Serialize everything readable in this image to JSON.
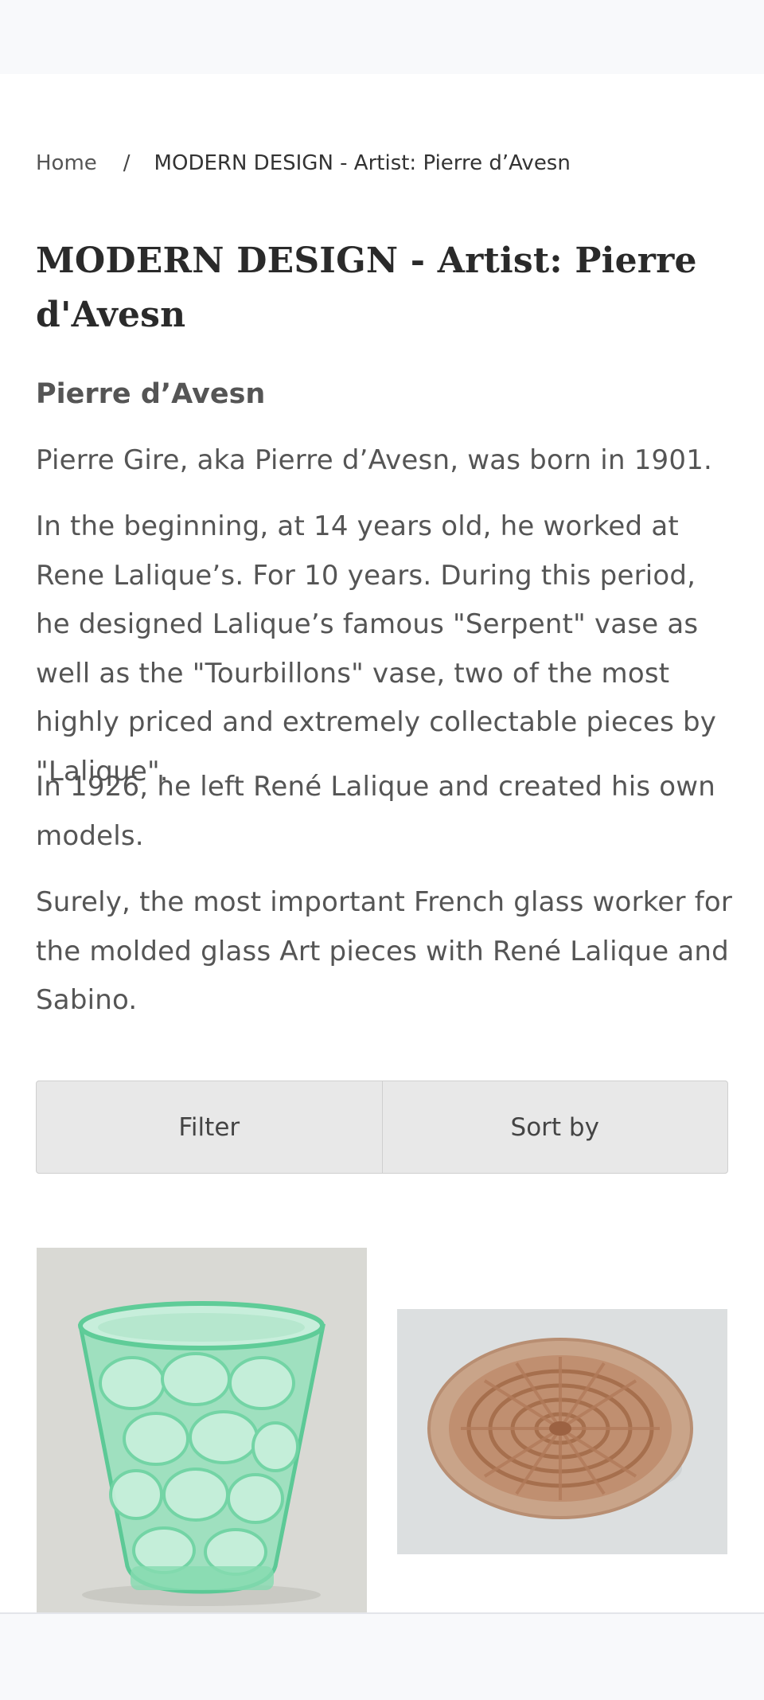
{
  "breadcrumb": {
    "home": "Home",
    "separator": "/",
    "current": "MODERN DESIGN - Artist: Pierre d’Avesn"
  },
  "page_title": "MODERN DESIGN - Artist: Pierre d'Avesn",
  "description": {
    "heading": "Pierre d’Avesn",
    "paragraphs": [
      "Pierre Gire, aka Pierre d’Avesn, was born in 1901.",
      "In the beginning, at 14 years old, he worked at Rene Lalique’s. For 10 years. During this period, he designed Lalique’s famous \"Serpent\" vase as well as the \"Tourbillons\" vase, two of the most highly priced and extremely collectable pieces by \"Lalique\".",
      "In 1926, he left René Lalique and created his own models.",
      "Surely, the most important French glass worker for the molded glass Art pieces with René Lalique and Sabino."
    ]
  },
  "controls": {
    "filter_label": "Filter",
    "sort_label": "Sort by"
  },
  "products": [
    {
      "image": "green-molded-glass-vase"
    },
    {
      "image": "amber-molded-glass-bowl"
    }
  ],
  "colors": {
    "page_background": "#ffffff",
    "header_background": "#f8f9fb",
    "control_background": "#e8e8e8",
    "body_text": "#555555",
    "title_text": "#2a2a2a"
  }
}
